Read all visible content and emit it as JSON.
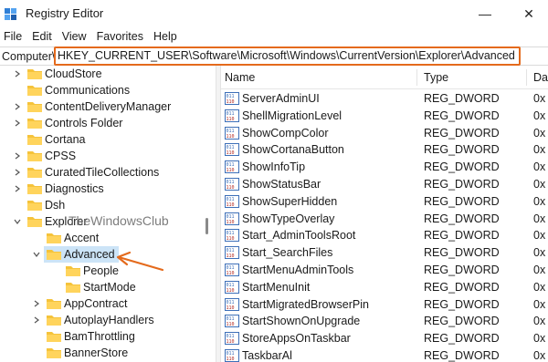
{
  "window": {
    "title": "Registry Editor",
    "minimize_glyph": "—",
    "close_glyph": "✕"
  },
  "menu": [
    "File",
    "Edit",
    "View",
    "Favorites",
    "Help"
  ],
  "address": {
    "label": "Computer\\",
    "path": "HKEY_CURRENT_USER\\Software\\Microsoft\\Windows\\CurrentVersion\\Explorer\\Advanced"
  },
  "watermark": "TheWindowsClub",
  "tree": [
    {
      "label": "CloudStore",
      "level": 0,
      "expand": "collapsed",
      "selected": false
    },
    {
      "label": "Communications",
      "level": 0,
      "expand": "none",
      "selected": false
    },
    {
      "label": "ContentDeliveryManager",
      "level": 0,
      "expand": "collapsed",
      "selected": false
    },
    {
      "label": "Controls Folder",
      "level": 0,
      "expand": "collapsed",
      "selected": false
    },
    {
      "label": "Cortana",
      "level": 0,
      "expand": "none",
      "selected": false
    },
    {
      "label": "CPSS",
      "level": 0,
      "expand": "collapsed",
      "selected": false
    },
    {
      "label": "CuratedTileCollections",
      "level": 0,
      "expand": "collapsed",
      "selected": false
    },
    {
      "label": "Diagnostics",
      "level": 0,
      "expand": "collapsed",
      "selected": false
    },
    {
      "label": "Dsh",
      "level": 0,
      "expand": "none",
      "selected": false
    },
    {
      "label": "Explorer",
      "level": 0,
      "expand": "expanded",
      "selected": false
    },
    {
      "label": "Accent",
      "level": 1,
      "expand": "none",
      "selected": false
    },
    {
      "label": "Advanced",
      "level": 1,
      "expand": "expanded",
      "selected": true
    },
    {
      "label": "People",
      "level": 2,
      "expand": "none",
      "selected": false
    },
    {
      "label": "StartMode",
      "level": 2,
      "expand": "none",
      "selected": false
    },
    {
      "label": "AppContract",
      "level": 1,
      "expand": "collapsed",
      "selected": false
    },
    {
      "label": "AutoplayHandlers",
      "level": 1,
      "expand": "collapsed",
      "selected": false
    },
    {
      "label": "BamThrottling",
      "level": 1,
      "expand": "none",
      "selected": false
    },
    {
      "label": "BannerStore",
      "level": 1,
      "expand": "none",
      "selected": false
    }
  ],
  "list": {
    "columns": [
      "Name",
      "Type",
      "Dat"
    ],
    "rows": [
      {
        "name": "ServerAdminUI",
        "type": "REG_DWORD",
        "data": "0x"
      },
      {
        "name": "ShellMigrationLevel",
        "type": "REG_DWORD",
        "data": "0x"
      },
      {
        "name": "ShowCompColor",
        "type": "REG_DWORD",
        "data": "0x"
      },
      {
        "name": "ShowCortanaButton",
        "type": "REG_DWORD",
        "data": "0x"
      },
      {
        "name": "ShowInfoTip",
        "type": "REG_DWORD",
        "data": "0x"
      },
      {
        "name": "ShowStatusBar",
        "type": "REG_DWORD",
        "data": "0x"
      },
      {
        "name": "ShowSuperHidden",
        "type": "REG_DWORD",
        "data": "0x"
      },
      {
        "name": "ShowTypeOverlay",
        "type": "REG_DWORD",
        "data": "0x"
      },
      {
        "name": "Start_AdminToolsRoot",
        "type": "REG_DWORD",
        "data": "0x"
      },
      {
        "name": "Start_SearchFiles",
        "type": "REG_DWORD",
        "data": "0x"
      },
      {
        "name": "StartMenuAdminTools",
        "type": "REG_DWORD",
        "data": "0x"
      },
      {
        "name": "StartMenuInit",
        "type": "REG_DWORD",
        "data": "0x"
      },
      {
        "name": "StartMigratedBrowserPin",
        "type": "REG_DWORD",
        "data": "0x"
      },
      {
        "name": "StartShownOnUpgrade",
        "type": "REG_DWORD",
        "data": "0x"
      },
      {
        "name": "StoreAppsOnTaskbar",
        "type": "REG_DWORD",
        "data": "0x"
      },
      {
        "name": "TaskbarAl",
        "type": "REG_DWORD",
        "data": "0x"
      }
    ]
  },
  "colors": {
    "folder": "#f5c33b",
    "selection": "#cce4f7",
    "highlight_border": "#e46a1c",
    "arrow": "#e46a1c"
  },
  "icons": {
    "app": "registry-icon",
    "folder": "folder-icon",
    "value": "reg-dword-icon",
    "arrow": "annotation-arrow"
  }
}
